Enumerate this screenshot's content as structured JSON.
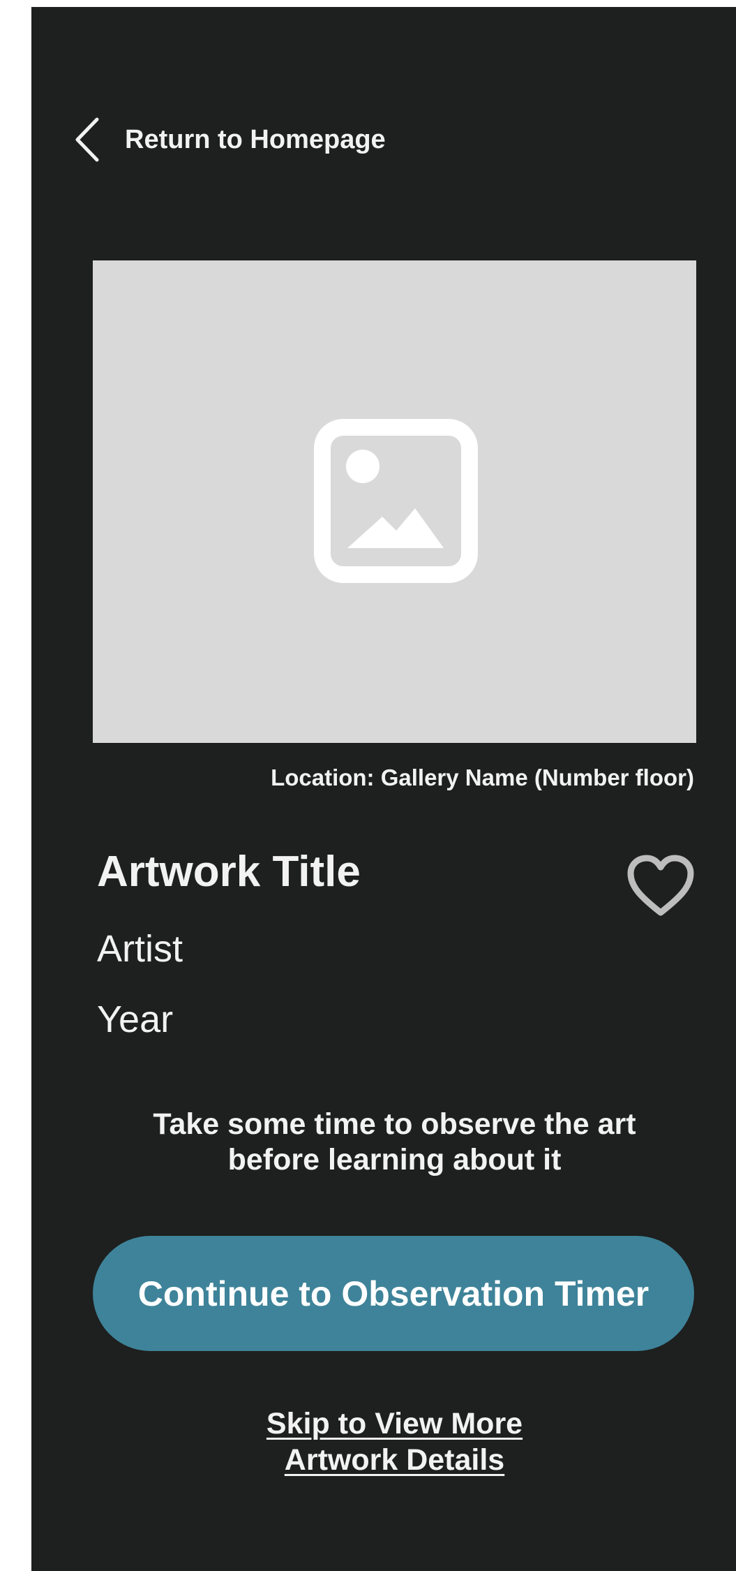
{
  "header": {
    "back_label": "Return to Homepage",
    "back_icon": "chevron-left-icon"
  },
  "artwork": {
    "image_icon": "image-placeholder-icon",
    "location": "Location: Gallery Name (Number floor)",
    "title": "Artwork Title",
    "artist": "Artist",
    "year": "Year",
    "favorite_icon": "heart-outline-icon"
  },
  "prompt": {
    "line1": "Take some time to observe the art",
    "line2": "before learning about it"
  },
  "actions": {
    "continue_label": "Continue to Observation Timer",
    "skip_line1": "Skip to View More",
    "skip_line2": "Artwork Details"
  },
  "colors": {
    "background": "#1e1f1f",
    "image_placeholder": "#d9d9d9",
    "accent": "#3e8399",
    "text": "#f2f2f2",
    "heart_outline": "#bdbdbd"
  }
}
